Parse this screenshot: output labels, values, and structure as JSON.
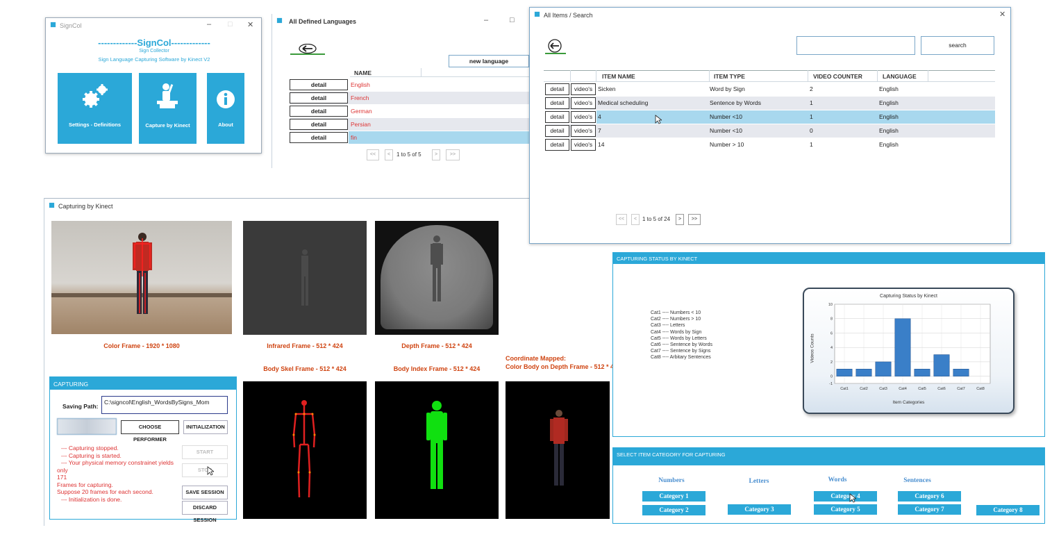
{
  "signcol": {
    "title": "SignCol",
    "heading": "-------------SignCol-------------",
    "subtitle": "Sign Collector",
    "tagline": "Sign Language Capturing Software by Kinect V2",
    "tiles": [
      {
        "label": "Settings - Definitions",
        "icon": "gear-icon"
      },
      {
        "label": "Capture by Kinect",
        "icon": "person-kinect-icon"
      },
      {
        "label": "About",
        "icon": "info-icon"
      }
    ]
  },
  "languages": {
    "title": "All Defined Languages",
    "new_button": "new language",
    "column": "NAME",
    "detail_label": "detail",
    "rows": [
      "English",
      "French",
      "German",
      "Persian",
      "fin"
    ],
    "pager": {
      "first": "<<",
      "prev": "<",
      "info": "1 to 5 of 5",
      "next": ">",
      "last": ">>"
    }
  },
  "items": {
    "title": "All Items / Search",
    "search_value": "",
    "search_button": "search",
    "columns": [
      "ITEM NAME",
      "ITEM TYPE",
      "VIDEO COUNTER",
      "LANGUAGE"
    ],
    "detail_label": "detail",
    "videos_label": "video's",
    "rows": [
      {
        "name": "Sicken",
        "type": "Word by Sign",
        "count": "2",
        "lang": "English"
      },
      {
        "name": "Medical scheduling",
        "type": "Sentence by Words",
        "count": "1",
        "lang": "English"
      },
      {
        "name": "4",
        "type": "Number <10",
        "count": "1",
        "lang": "English"
      },
      {
        "name": "7",
        "type": "Number <10",
        "count": "0",
        "lang": "English"
      },
      {
        "name": "14",
        "type": "Number > 10",
        "count": "1",
        "lang": "English"
      }
    ],
    "pager": {
      "first": "<<",
      "prev": "<",
      "info": "1 to 5 of 24",
      "next": ">",
      "last": ">>"
    }
  },
  "capture": {
    "title": "Capturing by Kinect",
    "frames": {
      "color": "Color Frame - 1920 * 1080",
      "infrared": "Infrared Frame - 512 * 424",
      "depth": "Depth Frame - 512 * 424",
      "skel": "Body Skel Frame - 512 * 424",
      "index": "Body Index Frame - 512 * 424",
      "mapped1": "Coordinate Mapped:",
      "mapped2": "Color Body on Depth Frame - 512 * 4"
    },
    "panel_title": "CAPTURING",
    "saving_label": "Saving Path:",
    "saving_value": "C:\\signcol\\English_WordsBySigns_Mom",
    "choose_performer": "CHOOSE PERFORMER",
    "initialization": "INITIALIZATION",
    "start": "START CAPTURIN",
    "stop": "STOP",
    "save": "SAVE SESSION",
    "discard": "DISCARD SESSION",
    "log": [
      "--- Capturing stopped.",
      "--- Capturing is started.",
      "--- Your physical memory constrainet yields",
      "only",
      "171",
      "Frames for capturing.",
      "Suppose 20 frames for each second.",
      "--- Initialization is done."
    ]
  },
  "status": {
    "panel_title": "CAPTURING STATUS BY KINECT",
    "legend": [
      "Cat1 ---- Numbers < 10",
      "Cat2 ---- Numbers > 10",
      "Cat3 ---- Letters",
      "Cat4 ---- Words by Sign",
      "Cat5 ---- Words by Letters",
      "Cat6 ---- Sentence by Words",
      "Cat7 ---- Sentence by Signs",
      "Cat8 ---- Arbitary Sentences"
    ]
  },
  "chart_data": {
    "type": "bar",
    "title": "Capturing Status by Kinect",
    "xlabel": "Item Categories",
    "ylabel": "Videos Counts",
    "categories": [
      "Cat1",
      "Cat2",
      "Cat3",
      "Cat4",
      "Cat5",
      "Cat6",
      "Cat7",
      "Cat8"
    ],
    "values": [
      1,
      1,
      2,
      8,
      1,
      3,
      1,
      0
    ],
    "ylim": [
      -1,
      10
    ],
    "yticks": [
      "-1",
      "0",
      "2",
      "4",
      "6",
      "8",
      "10"
    ],
    "grid": true,
    "bar_color": "#3a7fc8"
  },
  "select": {
    "panel_title": "SELECT ITEM CATEGORY FOR CAPTURING",
    "groups": [
      "Numbers",
      "Letters",
      "Words",
      "Sentences"
    ],
    "buttons": [
      "Category 1",
      "Category 2",
      "Category 3",
      "Category 4",
      "Category 5",
      "Category 6",
      "Category 7",
      "Category 8"
    ]
  },
  "colors": {
    "accent": "#2ba8d8",
    "link": "#dd3333",
    "caption": "#cf4411"
  }
}
